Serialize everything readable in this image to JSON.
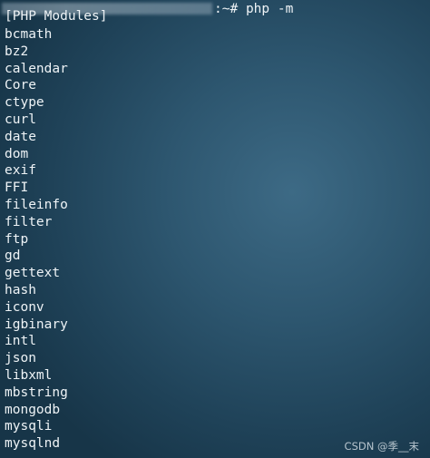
{
  "terminal": {
    "prompt_suffix": ":~#",
    "command": "php -m",
    "header": "[PHP Modules]",
    "modules": [
      "bcmath",
      "bz2",
      "calendar",
      "Core",
      "ctype",
      "curl",
      "date",
      "dom",
      "exif",
      "FFI",
      "fileinfo",
      "filter",
      "ftp",
      "gd",
      "gettext",
      "hash",
      "iconv",
      "igbinary",
      "intl",
      "json",
      "libxml",
      "mbstring",
      "mongodb",
      "mysqli",
      "mysqlnd"
    ]
  },
  "watermark": "CSDN @季__末",
  "colors": {
    "text": "#eef3f6",
    "background_center": "#3d6a85",
    "background_edge": "#173548"
  }
}
